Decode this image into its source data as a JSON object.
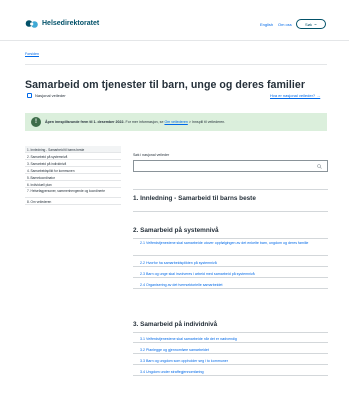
{
  "header": {
    "logo_text": "Helsedirektoratet",
    "nav_english": "English",
    "nav_about": "Om oss",
    "search_button": "Søk",
    "brand_color": "#025169"
  },
  "breadcrumb": "Forsiden",
  "page": {
    "title": "Samarbeid om tjenester til barn, unge og deres familier",
    "doc_type": "Nasjonal veileder",
    "what_is_link": "Hva er nasjonal veileder? →"
  },
  "notice": {
    "icon": "!",
    "bold_text": "Åpen innspillsrunde frem til 1. desember 2022.",
    "text": "For mer informasjon, se",
    "link_text": "Om veilederen",
    "tail_text": "> Innspill til veilederen.",
    "color": "#dbefdc"
  },
  "toc": {
    "items": [
      "1. Innledning - Samarbeid til barns beste",
      "2. Samarbeid på systemnivå",
      "3. Samarbeid på individnivå",
      "4. Samarbeidsplikt for kommunen",
      "5. Barnekoordinator",
      "6. Individuell plan",
      "7. Helsefagpersoner, sammenhengende og koordinerte",
      "8. Om veilederen"
    ]
  },
  "search": {
    "label": "Søk i nasjonal veileder",
    "placeholder": ""
  },
  "sections": [
    {
      "title": "1. Innledning - Samarbeid til barns beste",
      "items": []
    },
    {
      "title": "2. Samarbeid på systemnivå",
      "items": [
        "2.1 Velferdstjenestene skal samarbeide utover oppfølgingen av det enkelte barn, ungdom og deres familie",
        "2.2 Hvorfor ha samarbeidsplikten på systemnivå",
        "2.3 Barn og unge skal involveres i arbeid med samarbeid på systemnivå",
        "2.4 Organisering av det tverrsektorielle samarbeidet"
      ]
    },
    {
      "title": "3. Samarbeid på individnivå",
      "items": [
        "3.1 Velferdstjenestene skal samarbeide når det er nødvendig",
        "3.2 Planlegge og gjennomføre samarbeidet",
        "3.3 Barn og ungdom som oppholder seg i to kommuner",
        "3.4 Ungdom under straffegjennomføring"
      ]
    }
  ]
}
